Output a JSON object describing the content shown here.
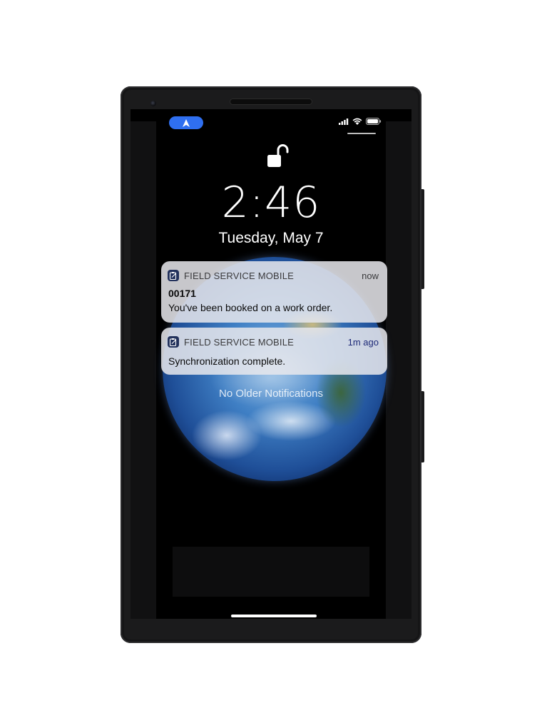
{
  "status_bar": {
    "location_icon": "navigation-arrow-icon",
    "signal_icon": "cellular-signal-icon",
    "wifi_icon": "wifi-icon",
    "battery_icon": "battery-icon"
  },
  "lock_screen": {
    "lock_icon": "unlocked-padlock-icon",
    "time": "2:46",
    "date": "Tuesday, May 7",
    "wallpaper": "earth-globe"
  },
  "notifications": [
    {
      "app_name": "FIELD SERVICE MOBILE",
      "app_icon": "clipboard-icon",
      "time": "now",
      "title": "00171",
      "body": "You've been booked on a work order."
    },
    {
      "app_name": "FIELD SERVICE MOBILE",
      "app_icon": "clipboard-icon",
      "time": "1m ago",
      "title": "",
      "body": "Synchronization complete."
    }
  ],
  "footer": {
    "no_older_text": "No Older Notifications"
  },
  "colors": {
    "status_pill": "#2f6ff0",
    "notification_bg": "#e8e8ec",
    "app_icon_bg": "#22315c",
    "phone_body": "#1b1b1c"
  }
}
